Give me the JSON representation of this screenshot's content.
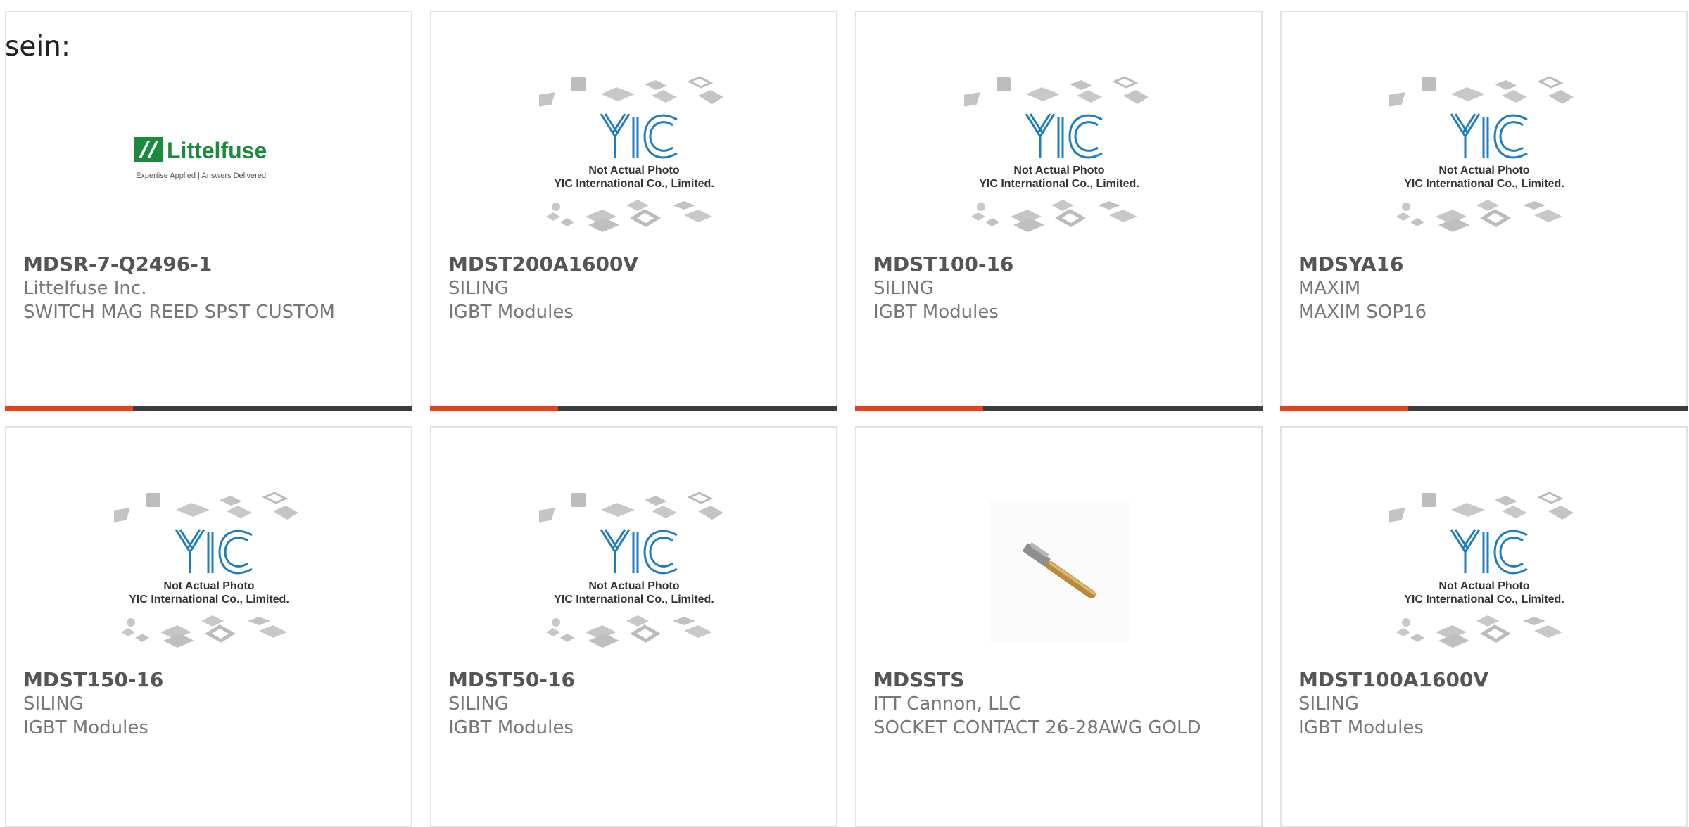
{
  "page": {
    "label": "sein:"
  },
  "cards": [
    {
      "part_number": "MDSR-7-Q2496-1",
      "manufacturer": "Littelfuse Inc.",
      "description": "SWITCH MAG REED SPST CUSTOM",
      "image": "littelfuse-logo",
      "logo_text": "Littelfuse",
      "logo_tagline": "Expertise Applied | Answers Delivered"
    },
    {
      "part_number": "MDST200A1600V",
      "manufacturer": "SILING",
      "description": "IGBT Modules",
      "image": "yic-placeholder",
      "placeholder_line1": "Not Actual Photo",
      "placeholder_line2": "YIC International Co., Limited."
    },
    {
      "part_number": "MDST100-16",
      "manufacturer": "SILING",
      "description": "IGBT Modules",
      "image": "yic-placeholder",
      "placeholder_line1": "Not Actual Photo",
      "placeholder_line2": "YIC International Co., Limited."
    },
    {
      "part_number": "MDSYA16",
      "manufacturer": "MAXIM",
      "description": "MAXIM SOP16",
      "image": "yic-placeholder",
      "placeholder_line1": "Not Actual Photo",
      "placeholder_line2": "YIC International Co., Limited."
    },
    {
      "part_number": "MDST150-16",
      "manufacturer": "SILING",
      "description": "IGBT Modules",
      "image": "yic-placeholder",
      "placeholder_line1": "Not Actual Photo",
      "placeholder_line2": "YIC International Co., Limited."
    },
    {
      "part_number": "MDST50-16",
      "manufacturer": "SILING",
      "description": "IGBT Modules",
      "image": "yic-placeholder",
      "placeholder_line1": "Not Actual Photo",
      "placeholder_line2": "YIC International Co., Limited."
    },
    {
      "part_number": "MDSSTS",
      "manufacturer": "ITT Cannon, LLC",
      "description": "SOCKET CONTACT 26-28AWG GOLD",
      "image": "socket-contact-photo"
    },
    {
      "part_number": "MDST100A1600V",
      "manufacturer": "SILING",
      "description": "IGBT Modules",
      "image": "yic-placeholder",
      "placeholder_line1": "Not Actual Photo",
      "placeholder_line2": "YIC International Co., Limited."
    }
  ],
  "colors": {
    "accent": "#e8401c",
    "bar": "#3c3c3c",
    "yic_blue": "#1e7cc0",
    "littelfuse_green": "#1a8a3c"
  }
}
